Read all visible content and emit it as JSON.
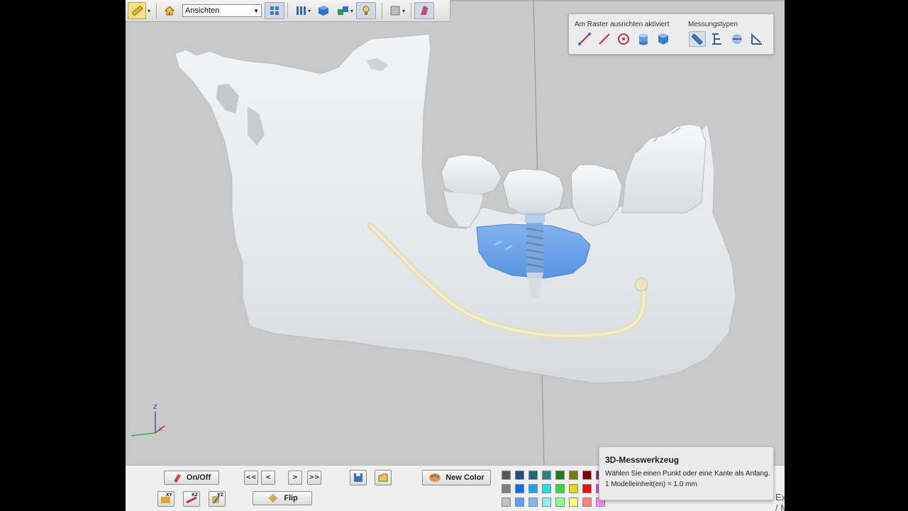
{
  "toolbar": {
    "views_label": "Ansichten"
  },
  "measure_panel": {
    "snap_label": "Am Raster ausrichten aktiviert",
    "types_label": "Messungstypen",
    "tools": [
      "line-measure",
      "straight-measure",
      "circle-measure",
      "cylinder-measure",
      "box-measure"
    ],
    "types": [
      "ruler",
      "height-angle",
      "diameter",
      "angle"
    ]
  },
  "axes": {
    "z": "Z",
    "x": "X"
  },
  "bottombar": {
    "onoff_label": "On/Off",
    "first_label": "<<",
    "prev_label": "<",
    "next_label": ">",
    "last_label": ">>",
    "flip_label": "Flip",
    "new_color_label": "New Color",
    "plane_xy": "XY",
    "plane_xz": "XZ",
    "plane_yz": "YZ"
  },
  "palette": [
    [
      "#595959",
      "#1f4e79",
      "#1a6b7a",
      "#2a7f7f",
      "#1e7b1e",
      "#7b7b00",
      "#7a0000",
      "#7a1f7a"
    ],
    [
      "#7f7f7f",
      "#0d6ff0",
      "#17a3ff",
      "#26e0e0",
      "#33dd33",
      "#dddd00",
      "#ee1111",
      "#ee33ee"
    ],
    [
      "#bfbfbf",
      "#5aa0ff",
      "#7db8ff",
      "#8cf0f0",
      "#88ff88",
      "#ffff77",
      "#ff8080",
      "#ff88ff"
    ]
  ],
  "tooltip": {
    "title": "3D-Messwerkzeug",
    "line1": "Wählen Sie einen Punkt oder eine Kante als Anfang.",
    "line2": "1 Modelleinheit(en) = 1.0 mm"
  },
  "explode_label": "Explode / Move Parts"
}
